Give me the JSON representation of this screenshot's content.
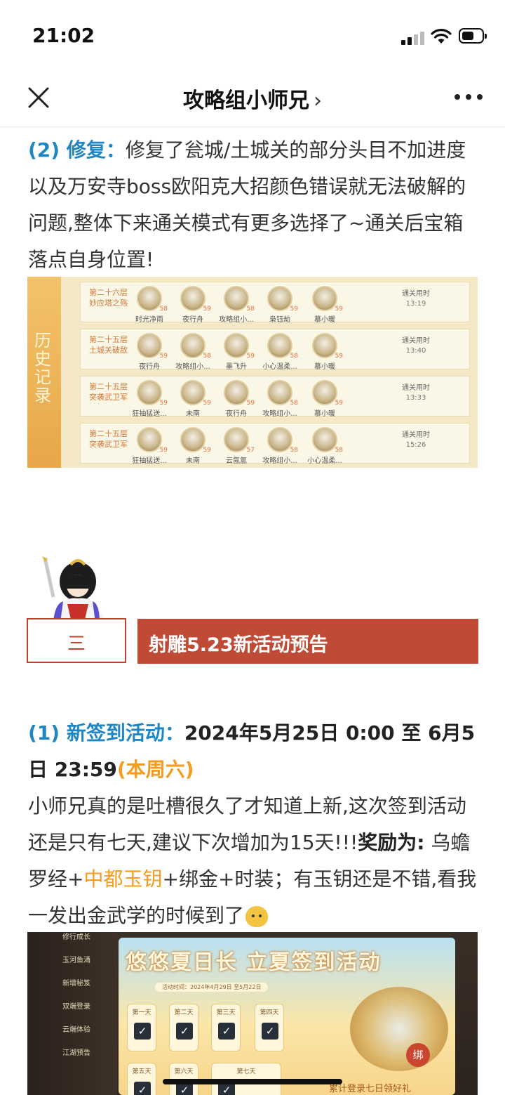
{
  "status_bar": {
    "time": "21:02"
  },
  "nav": {
    "title": "攻略组小师兄",
    "chevron": "›"
  },
  "para1": {
    "prefix": "(2) 修复：",
    "text": "修复了瓮城/土城关的部分头目不加进度以及万安寺boss欧阳克大招颜色错误就无法破解的问题,整体下来通关模式有更多选择了~通关后宝箱落点自身位置!"
  },
  "history": {
    "tab_label": "历史记录",
    "time_label": "通关用时",
    "records": [
      {
        "floor": "第二十六层",
        "name": "妙应塔之殇",
        "time": "13:19",
        "players": [
          {
            "n": "时光净雨",
            "lv": "58"
          },
          {
            "n": "夜行舟",
            "lv": "59"
          },
          {
            "n": "攻略组小...",
            "lv": "58"
          },
          {
            "n": "枭钰劫",
            "lv": "59"
          },
          {
            "n": "慕小暖",
            "lv": "59"
          }
        ]
      },
      {
        "floor": "第二十五层",
        "name": "土城关破敌",
        "time": "13:40",
        "players": [
          {
            "n": "夜行舟",
            "lv": "59"
          },
          {
            "n": "攻略组小...",
            "lv": "58"
          },
          {
            "n": "墨飞升",
            "lv": "59"
          },
          {
            "n": "小心温柔...",
            "lv": "58"
          },
          {
            "n": "慕小暖",
            "lv": "59"
          }
        ]
      },
      {
        "floor": "第二十五层",
        "name": "突袭武卫军",
        "time": "13:33",
        "players": [
          {
            "n": "狂抽猛送...",
            "lv": "59"
          },
          {
            "n": "未南",
            "lv": "59"
          },
          {
            "n": "夜行舟",
            "lv": "59"
          },
          {
            "n": "攻略组小...",
            "lv": "58"
          },
          {
            "n": "慕小暖",
            "lv": "59"
          }
        ]
      },
      {
        "floor": "第二十五层",
        "name": "突袭武卫军",
        "time": "15:26",
        "players": [
          {
            "n": "狂抽猛送...",
            "lv": "59"
          },
          {
            "n": "未南",
            "lv": "59"
          },
          {
            "n": "云氤氲",
            "lv": "57"
          },
          {
            "n": "攻略组小...",
            "lv": "58"
          },
          {
            "n": "小心温柔...",
            "lv": "58"
          }
        ]
      }
    ]
  },
  "section3": {
    "number": "三",
    "title": "射雕5.23新活动预告"
  },
  "para2": {
    "prefix": "(1) 新签到活动：",
    "date": "2024年5月25日 0:00 至 6月5日 23:59",
    "note": "(本周六)"
  },
  "para3": {
    "text1": "小师兄真的是吐槽很久了才知道上新,这次签到活动还是只有七天,建议下次增加为15天!!!",
    "reward_label": "奖励为:",
    "r1": " 乌蟾罗经+",
    "r2": "中都玉钥",
    "r3": "+绑金+时装；有玉钥还是不错,看我一发出金武学的时候到了"
  },
  "event": {
    "menu": [
      "修行成长",
      "玉河鱼涌",
      "新增秘笈",
      "双端登录",
      "云端体验",
      "江湖预告"
    ],
    "title": "悠悠夏日长 立夏签到活动",
    "time": "活动时间：2024年4月29日 至5月22日",
    "days": [
      "第一天",
      "第二天",
      "第三天",
      "第四天",
      "第五天",
      "第六天",
      "第七天"
    ],
    "bind": "绑",
    "accum": "累计登录七日领好礼"
  },
  "icons": {
    "close": "close-icon",
    "more": "more-icon",
    "signal": "signal-icon",
    "wifi": "wifi-icon",
    "battery": "battery-icon",
    "emoji": "doge-emoji-icon",
    "check": "checkmark-icon"
  }
}
